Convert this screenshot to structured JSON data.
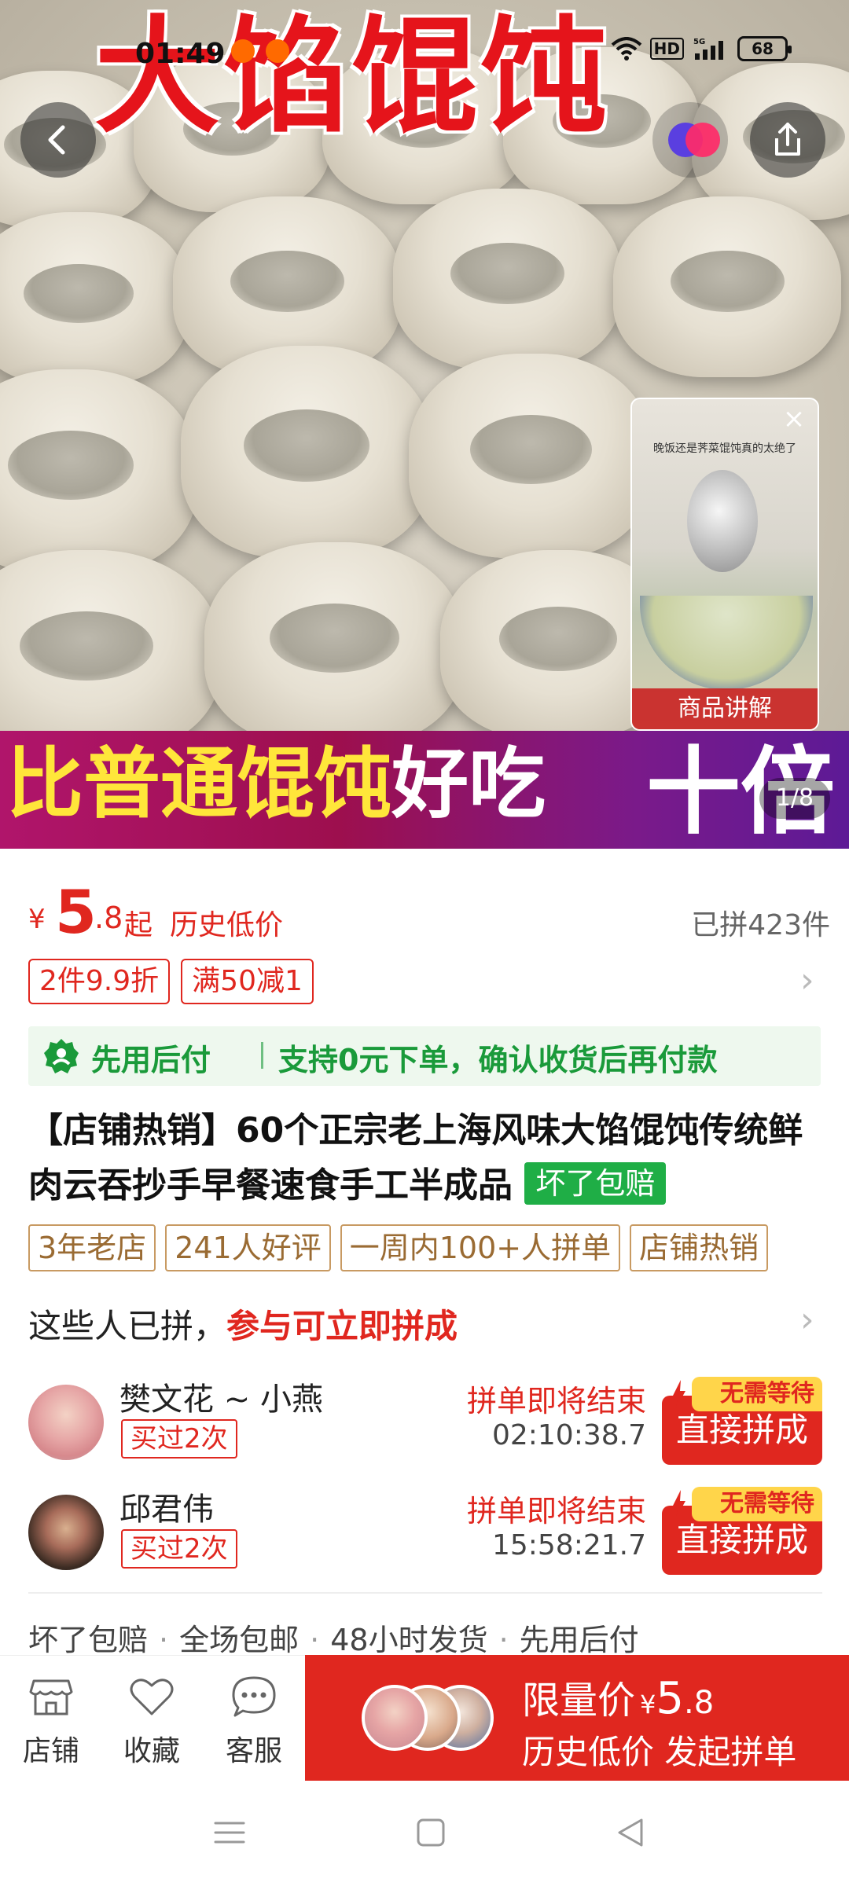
{
  "status_bar": {
    "time": "01:49",
    "network": "5G",
    "hd": "HD",
    "battery": "68"
  },
  "hero": {
    "title": "大馅馄饨",
    "banner_yellow": "比普通馄饨",
    "banner_white": "好吃",
    "banner_big": "十倍",
    "page_indicator": "1/8",
    "video_label": "商品讲解",
    "video_caption": "晚饭还是荠菜馄饨真的太绝了"
  },
  "price": {
    "currency": "¥",
    "int": "5",
    "dec": ".8",
    "suffix": "起",
    "history": "历史低价",
    "sold": "已拼423件"
  },
  "coupons": [
    "2件9.9折",
    "满50减1"
  ],
  "payment_line": {
    "text1": "先用后付",
    "text2": "支持0元下单，确认收货后再付款"
  },
  "product": {
    "title": "【店铺热销】60个正宗老上海风味大馅馄饨传统鲜肉云吞抄手早餐速食手工半成品",
    "badge": "坏了包赔"
  },
  "tags": [
    "3年老店",
    "241人好评",
    "一周内100+人拼单",
    "店铺热销"
  ],
  "group": {
    "head": "这些人已拼，",
    "head_red": "参与可立即拼成",
    "members": [
      {
        "name": "樊文花 ~ 小燕",
        "bought": "买过2次",
        "ending": "拼单即将结束",
        "timer": "02:10:38.7",
        "tag": "无需等待",
        "button": "直接拼成"
      },
      {
        "name": "邱君伟",
        "bought": "买过2次",
        "ending": "拼单即将结束",
        "timer": "15:58:21.7",
        "tag": "无需等待",
        "button": "直接拼成"
      }
    ]
  },
  "services": [
    "坏了包赔",
    "全场包邮",
    "48小时发货",
    "先用后付"
  ],
  "bottom_bar": {
    "store": "店铺",
    "favorite": "收藏",
    "service": "客服",
    "buy_line1": "限量价",
    "buy_currency": "¥",
    "buy_int": "5",
    "buy_dec": ".8",
    "buy_line2": "历史低价 发起拼单"
  },
  "colors": {
    "accent": "#e0271f",
    "green": "#1a9a3a",
    "tag_brown": "#9a6b33"
  }
}
